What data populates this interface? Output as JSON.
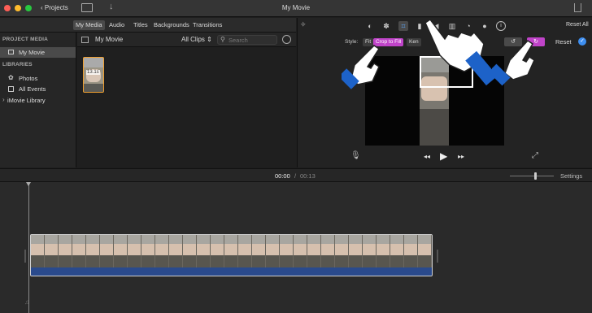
{
  "window": {
    "title": "My Movie"
  },
  "toolbar": {
    "projects_label": "Projects",
    "reset_all_label": "Reset All"
  },
  "tabs": [
    {
      "label": "My Media",
      "selected": true
    },
    {
      "label": "Audio",
      "selected": false
    },
    {
      "label": "Titles",
      "selected": false
    },
    {
      "label": "Backgrounds",
      "selected": false
    },
    {
      "label": "Transitions",
      "selected": false
    }
  ],
  "sidebar": {
    "project_media_heading": "PROJECT MEDIA",
    "project_item": "My Movie",
    "libraries_heading": "LIBRARIES",
    "items": [
      "Photos",
      "All Events",
      "iMovie Library"
    ]
  },
  "browser": {
    "title": "My Movie",
    "filter": "All Clips",
    "search_placeholder": "Search",
    "clip_duration": "13.1s"
  },
  "viewer": {
    "style_label": "Style:",
    "style_options": [
      "Fit",
      "Crop to Fill",
      "Ken"
    ],
    "reset_label": "Reset",
    "accent_color": "#c044c9",
    "selected_icon": "crop-icon"
  },
  "timeline": {
    "current_time": "00:00",
    "separator": "/",
    "total_time": "00:13",
    "settings_label": "Settings",
    "clip_color": "#2a4a8c"
  }
}
